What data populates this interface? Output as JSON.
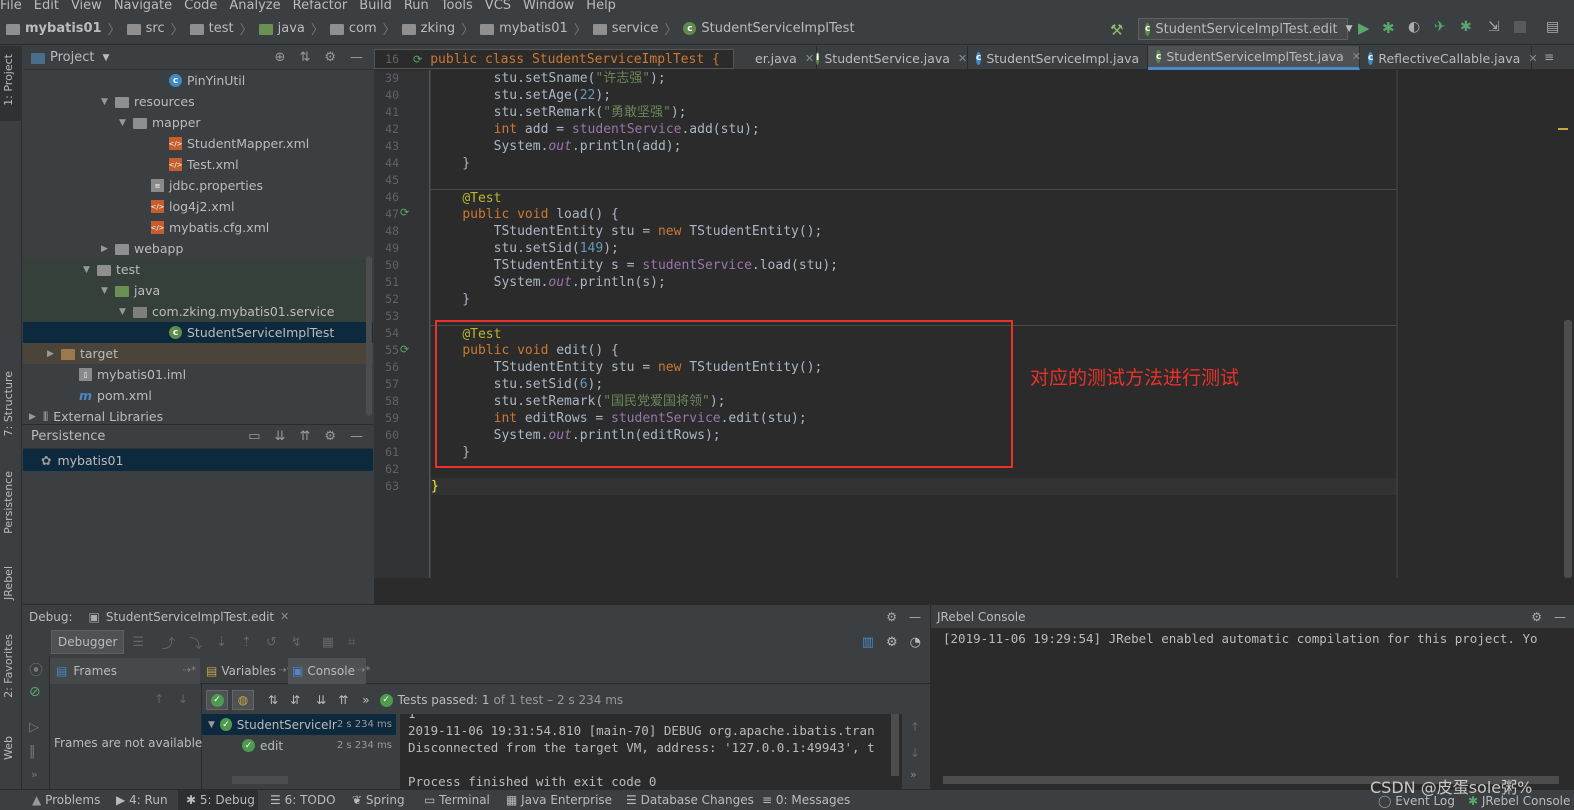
{
  "menu": [
    "File",
    "Edit",
    "View",
    "Navigate",
    "Code",
    "Analyze",
    "Refactor",
    "Build",
    "Run",
    "Tools",
    "VCS",
    "Window",
    "Help"
  ],
  "breadcrumbs": [
    "mybatis01",
    "src",
    "test",
    "java",
    "com",
    "zking",
    "mybatis01",
    "service",
    "StudentServiceImplTest"
  ],
  "run_config": "StudentServiceImplTest.edit",
  "left_strip": {
    "project": "1: Project",
    "structure": "7: Structure",
    "persistence": "Persistence",
    "jrebel": "JRebel",
    "favorites": "2: Favorites",
    "web": "Web"
  },
  "project_panel": {
    "title": "Project",
    "tree": [
      {
        "label": "PinYinUtil",
        "icon": "class-icon",
        "indent": 7
      },
      {
        "label": "resources",
        "icon": "folder-icon",
        "indent": 4,
        "arrow": "▼"
      },
      {
        "label": "mapper",
        "icon": "folder-icon",
        "indent": 5,
        "arrow": "▼"
      },
      {
        "label": "StudentMapper.xml",
        "icon": "xml-file-icon",
        "indent": 7
      },
      {
        "label": "Test.xml",
        "icon": "xml-file-icon",
        "indent": 7
      },
      {
        "label": "jdbc.properties",
        "icon": "properties-file-icon",
        "indent": 6
      },
      {
        "label": "log4j2.xml",
        "icon": "xml-file-icon",
        "indent": 6
      },
      {
        "label": "mybatis.cfg.xml",
        "icon": "xml-file-icon",
        "indent": 6
      },
      {
        "label": "webapp",
        "icon": "folder-icon",
        "indent": 4,
        "arrow": "▶"
      },
      {
        "label": "test",
        "icon": "folder-icon",
        "indent": 3,
        "arrow": "▼"
      },
      {
        "label": "java",
        "icon": "folder-green-icon",
        "indent": 4,
        "arrow": "▼"
      },
      {
        "label": "com.zking.mybatis01.service",
        "icon": "package-icon",
        "indent": 5,
        "arrow": "▼"
      },
      {
        "label": "StudentServiceImplTest",
        "icon": "test-class-icon",
        "indent": 7,
        "selected": true
      },
      {
        "label": "target",
        "icon": "folder-brown-icon",
        "indent": 1,
        "arrow": "▶"
      },
      {
        "label": "mybatis01.iml",
        "icon": "iml-file-icon",
        "indent": 2
      },
      {
        "label": "pom.xml",
        "icon": "maven-icon",
        "indent": 2
      },
      {
        "label": "External Libraries",
        "icon": "library-icon",
        "indent": 0,
        "arrow": "▶"
      }
    ]
  },
  "persistence_panel": {
    "title": "Persistence",
    "items": [
      "mybatis01"
    ]
  },
  "editor": {
    "tabs": [
      {
        "label": "er.java",
        "active": false
      },
      {
        "label": "StudentService.java",
        "active": false
      },
      {
        "label": "StudentServiceImpl.java",
        "active": false
      },
      {
        "label": "StudentServiceImplTest.java",
        "active": true
      },
      {
        "label": "ReflectiveCallable.java",
        "active": false
      }
    ],
    "sticky_line_number": "16",
    "sticky_line": "public class StudentServiceImplTest {",
    "line_numbers": [
      "39",
      "40",
      "41",
      "42",
      "43",
      "44",
      "45",
      "46",
      "47",
      "48",
      "49",
      "50",
      "51",
      "52",
      "53",
      "54",
      "55",
      "56",
      "57",
      "58",
      "59",
      "60",
      "61",
      "62",
      "63"
    ]
  },
  "annotation": {
    "text": "对应的测试方法进行测试",
    "color": "#e8322b"
  },
  "debug": {
    "label": "Debug:",
    "session_tab": "StudentServiceImplTest.edit",
    "debugger_tab": "Debugger",
    "frames_tab": "Frames",
    "variables_tab": "Variables",
    "console_tab": "Console",
    "frames_empty": "Frames are not available",
    "tests_passed_prefix": "Tests passed:",
    "tests_passed_count": "1",
    "tests_passed_suffix": "of 1 test – 2 s 234 ms",
    "test_tree": [
      {
        "label": "StudentServiceIr",
        "time": "2 s 234 ms"
      },
      {
        "label": "edit",
        "time": "2 s 234 ms"
      }
    ],
    "console_lines": [
      "1",
      "2019-11-06 19:31:54.810 [main-70] DEBUG org.apache.ibatis.tran",
      "Disconnected from the target VM, address: '127.0.0.1:49943', t",
      "",
      "Process finished with exit code 0"
    ]
  },
  "jrebel": {
    "title": "JRebel Console",
    "line": "[2019-11-06 19:29:54] JRebel enabled automatic compilation for this project. Yo"
  },
  "status_bar": {
    "problems": "Problems",
    "run": "4: Run",
    "debug": "5: Debug",
    "todo": "6: TODO",
    "spring": "Spring",
    "terminal": "Terminal",
    "java_enterprise": "Java Enterprise",
    "database_changes": "Database Changes",
    "messages": "0: Messages",
    "event_log": "Event Log",
    "jrebel_console": "JRebel Console"
  },
  "watermark": "CSDN @皮蛋sole粥%"
}
